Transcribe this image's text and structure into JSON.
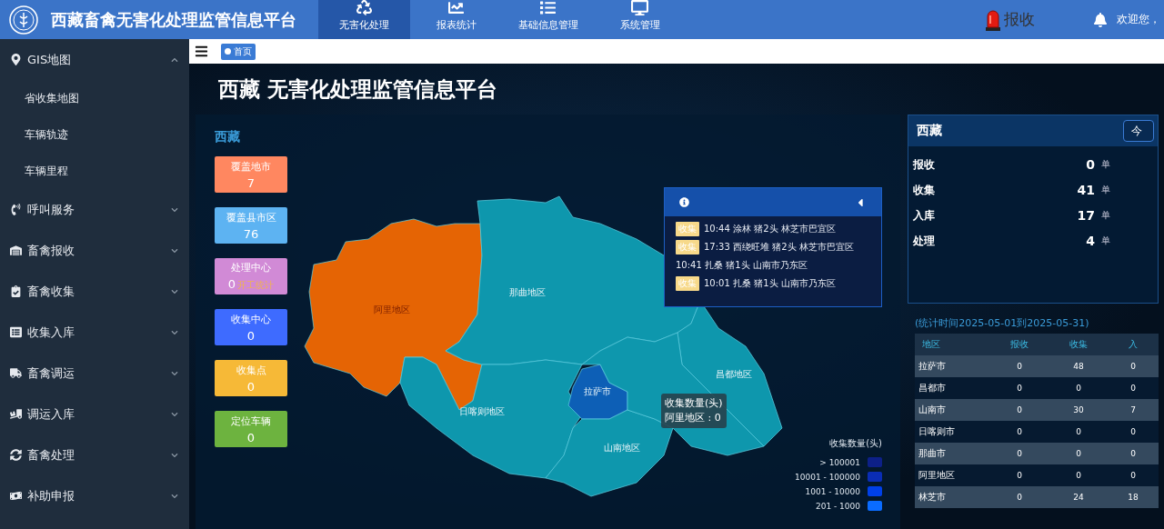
{
  "header": {
    "title": "西藏畜禽无害化处理监管信息平台",
    "nav": [
      {
        "label": "无害化处理",
        "selected": true
      },
      {
        "label": "报表统计",
        "selected": false
      },
      {
        "label": "基础信息管理",
        "selected": false
      },
      {
        "label": "系统管理",
        "selected": false
      }
    ],
    "alarm_label": "报收",
    "welcome": "欢迎您，"
  },
  "sidebar": {
    "items": [
      {
        "label": "GIS地图",
        "expanded": true,
        "children": [
          {
            "label": "省收集地图"
          },
          {
            "label": "车辆轨迹"
          },
          {
            "label": "车辆里程"
          }
        ]
      },
      {
        "label": "呼叫服务",
        "expanded": false
      },
      {
        "label": "畜禽报收",
        "expanded": false
      },
      {
        "label": "畜禽收集",
        "expanded": false
      },
      {
        "label": "收集入库",
        "expanded": false
      },
      {
        "label": "畜禽调运",
        "expanded": false
      },
      {
        "label": "调运入库",
        "expanded": false
      },
      {
        "label": "畜禽处理",
        "expanded": false
      },
      {
        "label": "补助申报",
        "expanded": false
      }
    ]
  },
  "breadcrumb": {
    "tabs": [
      {
        "label": "首页",
        "selected": true
      }
    ]
  },
  "page_title": "西藏 无害化处理监管信息平台",
  "map_panel": {
    "region_title": "西藏",
    "cards": [
      {
        "label": "覆盖地市",
        "value": "7",
        "color": "#ff8760"
      },
      {
        "label": "覆盖县市区",
        "value": "76",
        "color": "#5db3f2"
      },
      {
        "label": "处理中心",
        "value": "0",
        "link": "开工统计",
        "color": "#d18ad6"
      },
      {
        "label": "收集中心",
        "value": "0",
        "color": "#3e6bff"
      },
      {
        "label": "收集点",
        "value": "0",
        "color": "#f6b937"
      },
      {
        "label": "定位车辆",
        "value": "0",
        "color": "#6db33f"
      }
    ],
    "regions": [
      {
        "name": "阿里地区",
        "color": "#e56404"
      },
      {
        "name": "那曲地区",
        "color": "#0e97ad"
      },
      {
        "name": "日喀则地区",
        "color": "#0e97ad"
      },
      {
        "name": "拉萨市",
        "color": "#0d5fb6"
      },
      {
        "name": "昌都地区",
        "color": "#0e97ad"
      },
      {
        "name": "山南地区",
        "color": "#0e97ad"
      },
      {
        "color": "#0e97ad"
      }
    ],
    "feed": [
      {
        "badge": "收集",
        "text": "10:44 涂林 猪2头 林芝市巴宜区"
      },
      {
        "badge": "收集",
        "text": "17:33 西绕旺堆 猪2头 林芝市巴宜区"
      },
      {
        "text": "10:41 扎桑 猪1头 山南市乃东区"
      },
      {
        "badge": "收集",
        "text": "10:01 扎桑 猪1头 山南市乃东区"
      }
    ],
    "tooltip": {
      "title": "收集数量(头)",
      "text": "阿里地区 : 0"
    },
    "legend": {
      "title": "收集数量(头)",
      "items": [
        {
          "label": "> 100001",
          "color": "#0d2088"
        },
        {
          "label": "10001 - 100000",
          "color": "#0a2db5"
        },
        {
          "label": "1001 - 10000",
          "color": "#0040e8"
        },
        {
          "label": "201 - 1000",
          "color": "#0a6cff"
        }
      ]
    }
  },
  "summary": {
    "title": "西藏",
    "button": "今",
    "rows": [
      {
        "label": "报收",
        "value": "0",
        "unit": "单"
      },
      {
        "label": "收集",
        "value": "41",
        "unit": "单"
      },
      {
        "label": "入库",
        "value": "17",
        "unit": "单"
      },
      {
        "label": "处理",
        "value": "4",
        "unit": "单"
      }
    ]
  },
  "table": {
    "caption": "(统计时间2025-05-01到2025-05-31)",
    "columns": [
      "地区",
      "报收",
      "收集",
      "入"
    ],
    "rows": [
      [
        "拉萨市",
        "0",
        "48",
        "0"
      ],
      [
        "昌都市",
        "0",
        "0",
        "0"
      ],
      [
        "山南市",
        "0",
        "30",
        "7"
      ],
      [
        "日喀则市",
        "0",
        "0",
        "0"
      ],
      [
        "那曲市",
        "0",
        "0",
        "0"
      ],
      [
        "阿里地区",
        "0",
        "0",
        "0"
      ],
      [
        "林芝市",
        "0",
        "24",
        "18"
      ]
    ]
  }
}
